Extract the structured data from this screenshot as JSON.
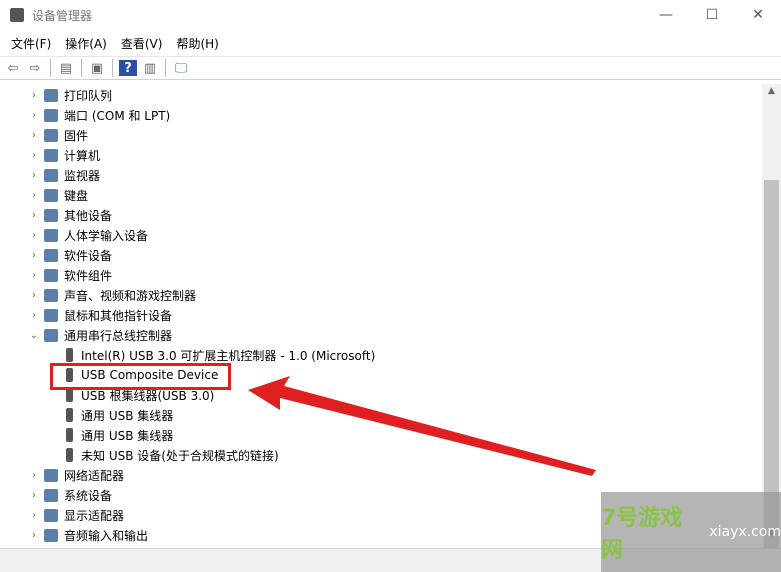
{
  "window": {
    "title": "设备管理器",
    "minimize": "—",
    "maximize": "☐",
    "close": "✕"
  },
  "menu": [
    "文件(F)",
    "操作(A)",
    "查看(V)",
    "帮助(H)"
  ],
  "toolbar": [
    "back-icon",
    "forward-icon",
    "show-hide-console-tree-icon",
    "properties-icon",
    "help-icon",
    "action-pane-icon",
    "monitor-scan-icon"
  ],
  "tree": [
    {
      "label": "打印队列",
      "expanded": false
    },
    {
      "label": "端口 (COM 和 LPT)",
      "expanded": false
    },
    {
      "label": "固件",
      "expanded": false
    },
    {
      "label": "计算机",
      "expanded": false
    },
    {
      "label": "监视器",
      "expanded": false
    },
    {
      "label": "键盘",
      "expanded": false
    },
    {
      "label": "其他设备",
      "expanded": false
    },
    {
      "label": "人体学输入设备",
      "expanded": false
    },
    {
      "label": "软件设备",
      "expanded": false
    },
    {
      "label": "软件组件",
      "expanded": false
    },
    {
      "label": "声音、视频和游戏控制器",
      "expanded": false
    },
    {
      "label": "鼠标和其他指针设备",
      "expanded": false
    },
    {
      "label": "通用串行总线控制器",
      "expanded": true,
      "children": [
        "Intel(R) USB 3.0 可扩展主机控制器 - 1.0 (Microsoft)",
        "USB Composite Device",
        "USB 根集线器(USB 3.0)",
        "通用 USB 集线器",
        "通用 USB 集线器",
        "未知 USB 设备(处于合规模式的链接)"
      ]
    },
    {
      "label": "网络适配器",
      "expanded": false
    },
    {
      "label": "系统设备",
      "expanded": false
    },
    {
      "label": "显示适配器",
      "expanded": false
    },
    {
      "label": "音频输入和输出",
      "expanded": false
    }
  ],
  "annotation": {
    "highlight_color": "#e02020"
  },
  "watermark": {
    "text": "7号游戏网",
    "sub": "xiayx.com"
  }
}
